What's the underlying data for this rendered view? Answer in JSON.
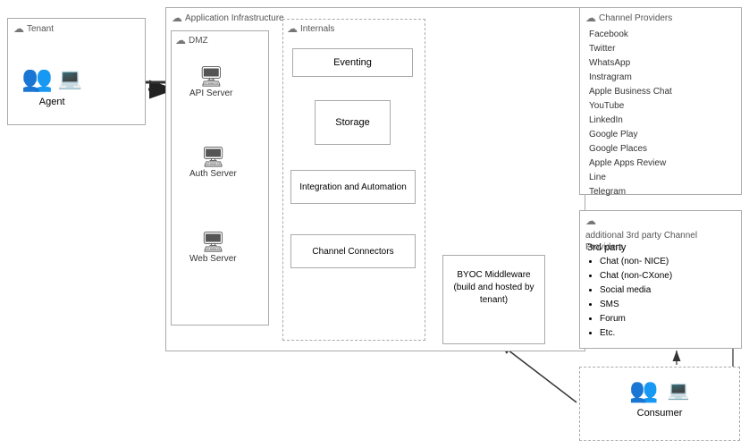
{
  "tenant": {
    "label": "Tenant",
    "agent_label": "Agent"
  },
  "app_infra": {
    "label": "Application Infrastructure"
  },
  "dmz": {
    "label": "DMZ"
  },
  "internals": {
    "label": "Internals"
  },
  "servers": {
    "api": "API Server",
    "auth": "Auth Server",
    "web": "Web Server"
  },
  "components": {
    "eventing": "Eventing",
    "storage": "Storage",
    "integration": "Integration and Automation",
    "channel_connectors": "Channel Connectors"
  },
  "channel_providers": {
    "label": "Channel Providers",
    "items": [
      "Facebook",
      "Twitter",
      "WhatsApp",
      "Instragram",
      "Apple Business Chat",
      "YouTube",
      "LinkedIn",
      "Google Play",
      "Google Places",
      "Apple Apps Review",
      "Line",
      "Telegram"
    ]
  },
  "additional": {
    "label": "additional 3rd party Channel Providers",
    "sublabel": "3rd party",
    "items": [
      "Chat (non- NICE)",
      "Chat (non-CXone)",
      "Social media",
      "SMS",
      "Forum",
      "Etc."
    ]
  },
  "byoc": {
    "label": "BYOC Middleware (build and hosted by tenant)"
  },
  "consumer": {
    "label": "Consumer"
  }
}
